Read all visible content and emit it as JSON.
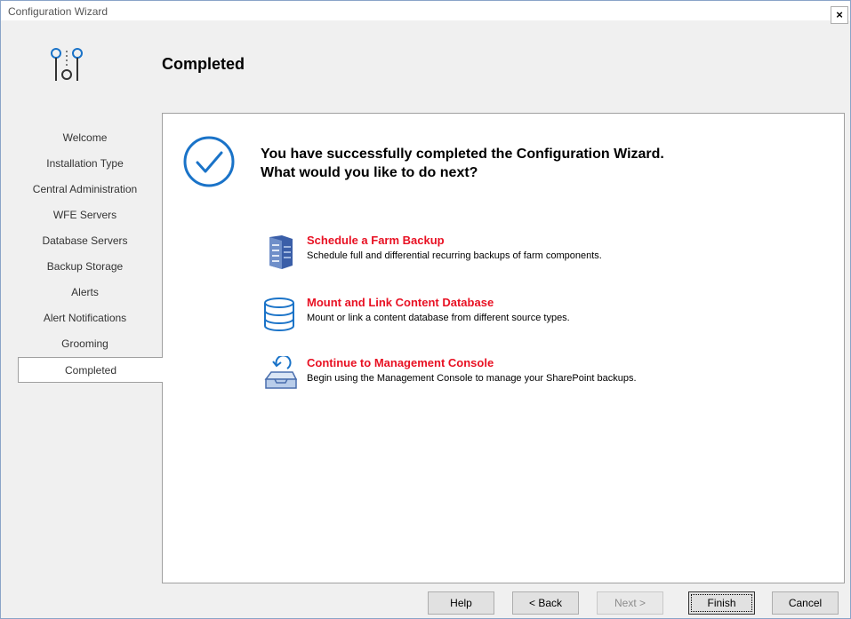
{
  "window": {
    "title": "Configuration Wizard",
    "close_label": "×"
  },
  "header": {
    "title": "Completed",
    "icon": "wizard-steps-icon"
  },
  "nav": {
    "items": [
      {
        "label": "Welcome"
      },
      {
        "label": "Installation Type"
      },
      {
        "label": "Central Administration"
      },
      {
        "label": "WFE Servers"
      },
      {
        "label": "Database Servers"
      },
      {
        "label": "Backup Storage"
      },
      {
        "label": "Alerts"
      },
      {
        "label": "Alert Notifications"
      },
      {
        "label": "Grooming"
      },
      {
        "label": "Completed"
      }
    ],
    "active": "Completed"
  },
  "main": {
    "heading_line1": "You have successfully completed the Configuration Wizard.",
    "heading_line2": "What would you like to do next?",
    "options": [
      {
        "title": "Schedule a Farm Backup",
        "description": "Schedule full and differential recurring backups of farm components.",
        "icon": "server-backup-icon"
      },
      {
        "title": "Mount and Link Content Database",
        "description": "Mount or link a content database from different source types.",
        "icon": "database-icon"
      },
      {
        "title": "Continue to Management Console",
        "description": "Begin using the Management Console to manage your SharePoint backups.",
        "icon": "console-tray-icon"
      }
    ]
  },
  "footer": {
    "help": "Help",
    "back": "< Back",
    "next": "Next >",
    "finish": "Finish",
    "cancel": "Cancel"
  },
  "colors": {
    "accent_blue": "#1a73c8",
    "link_red": "#e81123"
  }
}
